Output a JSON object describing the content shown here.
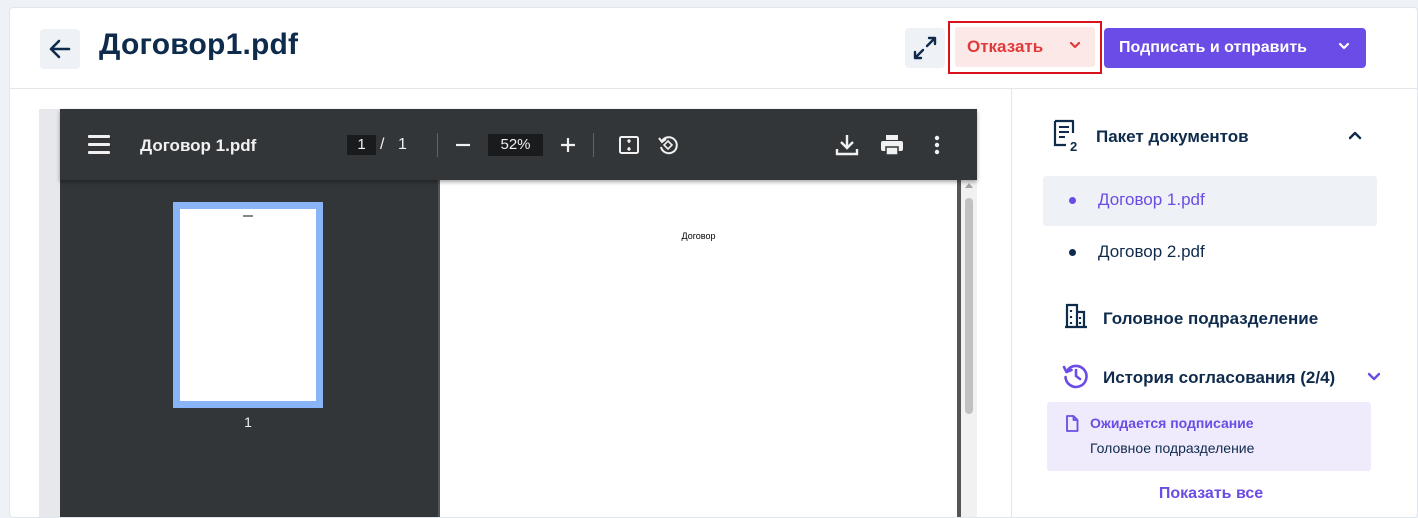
{
  "header": {
    "title": "Договор1.pdf",
    "reject_label": "Отказать",
    "sign_label": "Подписать и отправить"
  },
  "viewer": {
    "file_name": "Договор 1.pdf",
    "current_page": "1",
    "page_separator": "/",
    "total_pages": "1",
    "zoom": "52%",
    "thumbnail_label": "1",
    "page_content": "Договор"
  },
  "sidebar": {
    "package_title": "Пакет документов",
    "package_badge": "2",
    "documents": [
      {
        "label": "Договор 1.pdf",
        "active": true
      },
      {
        "label": "Договор 2.pdf",
        "active": false
      }
    ],
    "department": "Головное подразделение",
    "history_title": "История согласования (2/4)",
    "history_status": {
      "title": "Ожидается подписание",
      "subtitle": "Головное подразделение"
    },
    "show_all": "Показать все"
  },
  "colors": {
    "primary": "#6b4ce6",
    "danger": "#e03a3a",
    "danger_bg": "#fde8e8",
    "text_dark": "#0f2b4c",
    "viewer_bg": "#323639"
  }
}
